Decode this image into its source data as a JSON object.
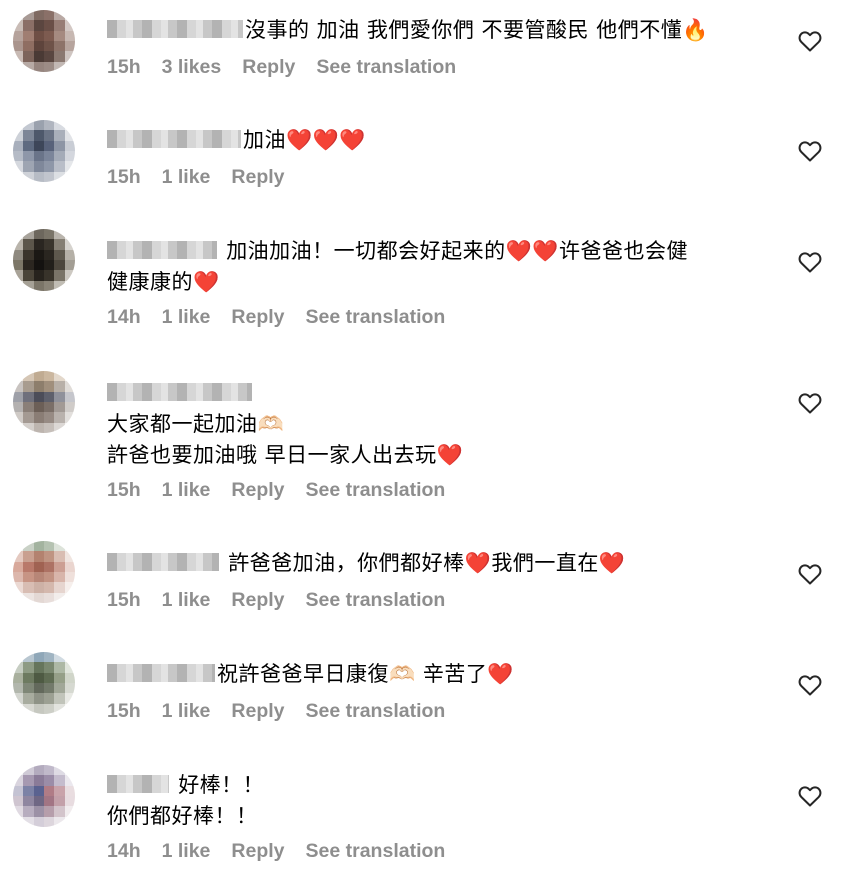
{
  "icons": {
    "like": "heart-outline-icon"
  },
  "comments": [
    {
      "text": "沒事的 加油 我們愛你們 不要管酸民 他們不懂🔥",
      "time": "15h",
      "likes": "3 likes",
      "reply": "Reply",
      "translate": "See translation"
    },
    {
      "text": "加油❤️❤️❤️",
      "time": "15h",
      "likes": "1 like",
      "reply": "Reply"
    },
    {
      "text_line1": "加油加油！一切都会好起来的❤️❤️许爸爸也会健",
      "text_line2": "健康康的❤️",
      "time": "14h",
      "likes": "1 like",
      "reply": "Reply",
      "translate": "See translation"
    },
    {
      "text_line1": "大家都一起加油🫶🏻",
      "text_line2": "許爸也要加油哦 早日一家人出去玩❤️",
      "time": "15h",
      "likes": "1 like",
      "reply": "Reply",
      "translate": "See translation"
    },
    {
      "text": "許爸爸加油，你們都好棒❤️我們一直在❤️",
      "time": "15h",
      "likes": "1 like",
      "reply": "Reply",
      "translate": "See translation"
    },
    {
      "text": "祝許爸爸早日康復🫶🏻 辛苦了❤️",
      "time": "15h",
      "likes": "1 like",
      "reply": "Reply",
      "translate": "See translation"
    },
    {
      "text_line1": "好棒！！",
      "text_line2": "你們都好棒！！",
      "time": "14h",
      "likes": "1 like",
      "reply": "Reply",
      "translate": "See translation"
    }
  ]
}
